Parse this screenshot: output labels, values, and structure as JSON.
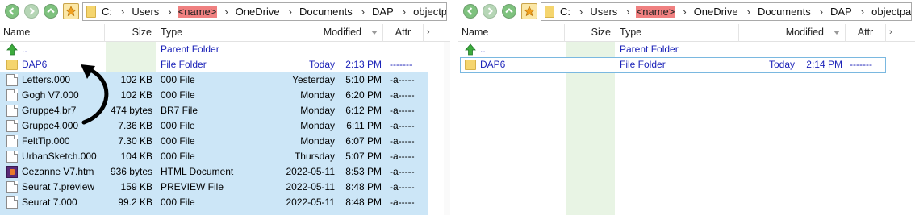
{
  "left_pane": {
    "path": [
      "C:",
      "Users",
      "<name>",
      "OneDrive",
      "Documents",
      "DAP",
      "objectpacks"
    ],
    "columns": {
      "name": "Name",
      "size": "Size",
      "type": "Type",
      "modified": "Modified",
      "attr": "Attr"
    },
    "rows": [
      {
        "icon": "up-arrow-icon",
        "name": "..",
        "size": "",
        "type": "Parent Folder",
        "day": "",
        "time": "",
        "attr": ""
      },
      {
        "icon": "folder-icon",
        "name": "DAP6",
        "size": "",
        "type": "File Folder",
        "day": "Today",
        "time": "2:13 PM",
        "attr": "-------"
      },
      {
        "icon": "file-icon",
        "name": "Letters.000",
        "size": "102 KB",
        "type": "000 File",
        "day": "Yesterday",
        "time": "5:10 PM",
        "attr": "-a-----"
      },
      {
        "icon": "file-icon",
        "name": "Gogh V7.000",
        "size": "102 KB",
        "type": "000 File",
        "day": "Monday",
        "time": "6:20 PM",
        "attr": "-a-----"
      },
      {
        "icon": "file-icon",
        "name": "Gruppe4.br7",
        "size": "474 bytes",
        "type": "BR7 File",
        "day": "Monday",
        "time": "6:12 PM",
        "attr": "-a-----"
      },
      {
        "icon": "file-icon",
        "name": "Gruppe4.000",
        "size": "7.36 KB",
        "type": "000 File",
        "day": "Monday",
        "time": "6:11 PM",
        "attr": "-a-----"
      },
      {
        "icon": "file-icon",
        "name": "FeltTip.000",
        "size": "7.30 KB",
        "type": "000 File",
        "day": "Monday",
        "time": "6:07 PM",
        "attr": "-a-----"
      },
      {
        "icon": "file-icon",
        "name": "UrbanSketch.000",
        "size": "104 KB",
        "type": "000 File",
        "day": "Thursday",
        "time": "5:07 PM",
        "attr": "-a-----"
      },
      {
        "icon": "html-icon",
        "name": "Cezanne V7.htm",
        "size": "936 bytes",
        "type": "HTML Document",
        "day": "2022-05-11",
        "time": "8:53 PM",
        "attr": "-a-----"
      },
      {
        "icon": "file-icon",
        "name": "Seurat 7.preview",
        "size": "159 KB",
        "type": "PREVIEW File",
        "day": "2022-05-11",
        "time": "8:48 PM",
        "attr": "-a-----"
      },
      {
        "icon": "file-icon",
        "name": "Seurat 7.000",
        "size": "99.2 KB",
        "type": "000 File",
        "day": "2022-05-11",
        "time": "8:48 PM",
        "attr": "-a-----"
      }
    ]
  },
  "right_pane": {
    "path": [
      "C:",
      "Users",
      "<name>",
      "OneDrive",
      "Documents",
      "DAP",
      "objectpacks"
    ],
    "columns": {
      "name": "Name",
      "size": "Size",
      "type": "Type",
      "modified": "Modified",
      "attr": "Attr"
    },
    "rows": [
      {
        "icon": "up-arrow-icon",
        "name": "..",
        "size": "",
        "type": "Parent Folder",
        "day": "",
        "time": "",
        "attr": ""
      },
      {
        "icon": "folder-icon",
        "name": "DAP6",
        "size": "",
        "type": "File Folder",
        "day": "Today",
        "time": "2:14 PM",
        "attr": "-------"
      }
    ]
  },
  "icons": {
    "back": "back-arrow-icon",
    "forward": "forward-arrow-icon",
    "up": "up-arrow-icon",
    "favorites": "favorites-star-icon",
    "annotation": "curved-arrow-annotation"
  },
  "colors": {
    "selection": "#cce6f7",
    "link_blue": "#1b22b8",
    "redaction": "#f08080",
    "folder": "#f5d56e",
    "nav_green": "#7ec27e"
  }
}
